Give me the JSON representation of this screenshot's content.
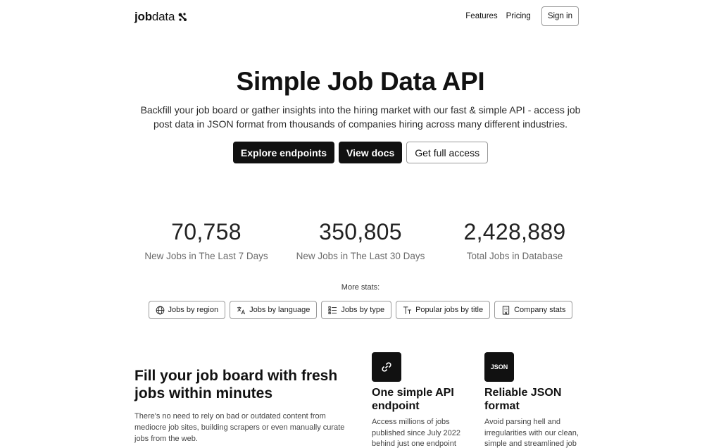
{
  "header": {
    "logo_bold": "job",
    "logo_light": "data",
    "nav": [
      "Features",
      "Pricing"
    ],
    "signin": "Sign in"
  },
  "hero": {
    "title": "Simple Job Data API",
    "subtitle": "Backfill your job board or gather insights into the hiring market with our fast & simple API - access job post data in JSON format from thousands of companies hiring across many different industries.",
    "buttons": {
      "explore": "Explore endpoints",
      "docs": "View docs",
      "access": "Get full access"
    }
  },
  "stats": [
    {
      "value": "70,758",
      "label": "New Jobs in The Last 7 Days"
    },
    {
      "value": "350,805",
      "label": "New Jobs in The Last 30 Days"
    },
    {
      "value": "2,428,889",
      "label": "Total Jobs in Database"
    }
  ],
  "more_stats": {
    "label": "More stats:",
    "chips": [
      {
        "label": "Jobs by region",
        "icon": "globe-icon"
      },
      {
        "label": "Jobs by language",
        "icon": "translate-icon"
      },
      {
        "label": "Jobs by type",
        "icon": "list-icon"
      },
      {
        "label": "Popular jobs by title",
        "icon": "text-size-icon"
      },
      {
        "label": "Company stats",
        "icon": "building-icon"
      }
    ]
  },
  "feature": {
    "title": "Fill your job board with fresh jobs within minutes",
    "text": "There's no need to rely on bad or outdated content from mediocre job sites, building scrapers or even manually curate jobs from the web."
  },
  "cards": [
    {
      "title": "One simple API endpoint",
      "text": "Access millions of jobs published since July 2022 behind just one endpoint",
      "icon": "link-icon"
    },
    {
      "title": "Reliable JSON format",
      "icon_text": "JSON",
      "text": "Avoid parsing hell and irregularities with our clean, simple and streamlined job"
    }
  ]
}
